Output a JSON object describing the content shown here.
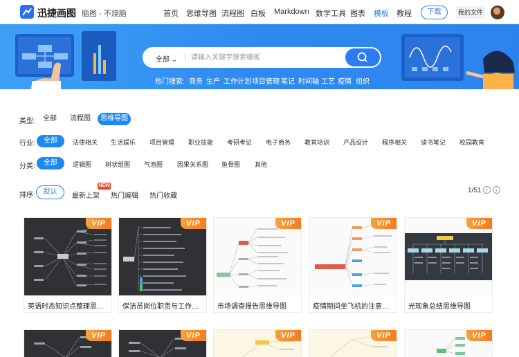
{
  "header": {
    "brand": "迅捷画图",
    "slogan": "脑图 - 不烧脑",
    "nav": [
      "首页",
      "思维导图",
      "流程图",
      "白板",
      "Markdown",
      "数学工具",
      "图表",
      "模板",
      "教程"
    ],
    "active_nav": "模板",
    "download_label": "下载",
    "my_files_label": "我的文件"
  },
  "search": {
    "scope": "全部",
    "placeholder": "请输入关键字搜索模板",
    "hot_label": "热门搜索:",
    "hot": [
      "商务",
      "生产",
      "工作计划",
      "项目管理",
      "笔记",
      "时间轴",
      "工艺",
      "疫情",
      "组织"
    ]
  },
  "filters": {
    "type_label": "类型:",
    "types": [
      "全部",
      "流程图",
      "思维导图"
    ],
    "industry_label": "行业:",
    "industries": [
      "全部",
      "法律相关",
      "生活娱乐",
      "项目管理",
      "职业技能",
      "考研考证",
      "电子商务",
      "教育培训",
      "产品设计",
      "程序相关",
      "读书笔记",
      "校园教育"
    ],
    "category_label": "分类:",
    "categories": [
      "全部",
      "逻辑图",
      "树状组图",
      "气泡图",
      "因果关系图",
      "鱼骨图",
      "其他"
    ]
  },
  "sort": {
    "label": "排序:",
    "options": [
      "默认",
      "最新上架",
      "热门编辑",
      "热门收藏"
    ],
    "new_badge": "NEW",
    "page": "1/51"
  },
  "vip_label": "VIP",
  "templates": [
    {
      "title": "英语时态知识点整理思维导图",
      "theme": "dark"
    },
    {
      "title": "保洁员岗位职责与工作标准思维导图",
      "theme": "dark"
    },
    {
      "title": "市场调查报告思维导图",
      "theme": "light"
    },
    {
      "title": "疫情期间坐飞机的注意事项思维导图",
      "theme": "light"
    },
    {
      "title": "光现象总结思维导图",
      "theme": "light"
    }
  ],
  "colors": {
    "accent": "#2b7bf3",
    "vip": "#f47b20",
    "banner": "#2f8af0"
  }
}
